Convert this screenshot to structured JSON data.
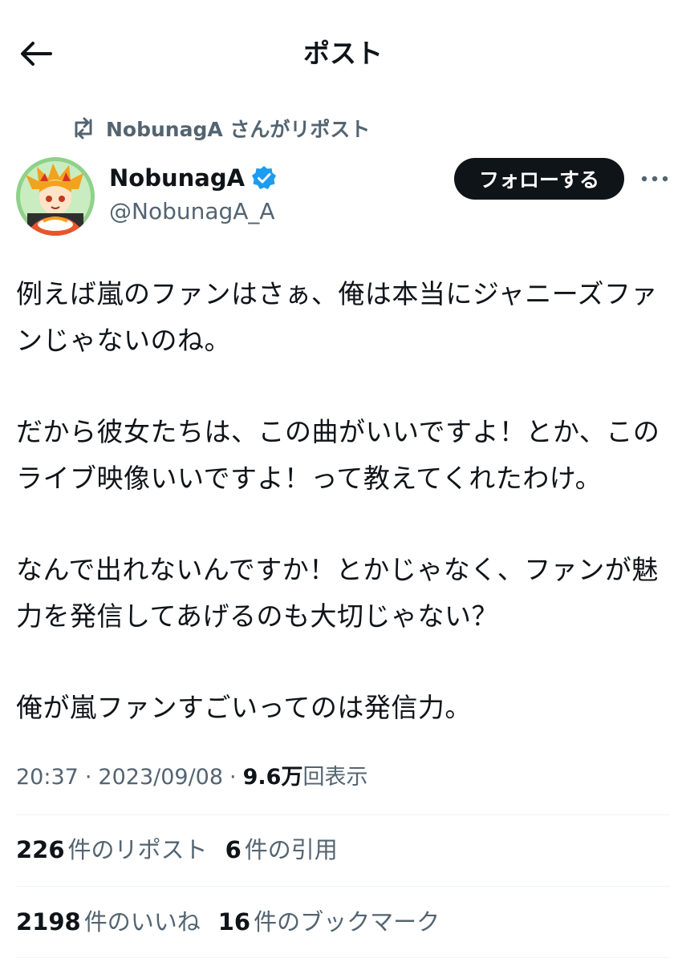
{
  "header": {
    "title": "ポスト",
    "back_icon": "arrow-left-icon"
  },
  "repost_context": {
    "icon": "repost-icon",
    "text": "NobunagA さんがリポスト"
  },
  "author": {
    "name": "NobunagA",
    "verified_icon": "verified-badge-icon",
    "handle": "@NobunagA_A",
    "follow_label": "フォローする",
    "more_icon": "more-icon"
  },
  "post": {
    "paragraphs": [
      "例えば嵐のファンはさぁ、俺は本当にジャニーズファンじゃないのね。",
      "だから彼女たちは、この曲がいいですよ！とか、このライブ映像いいですよ！って教えてくれたわけ。",
      "なんで出れないんですか！とかじゃなく、ファンが魅力を発信してあげるのも大切じゃない？",
      "俺が嵐ファンすごいってのは発信力。"
    ]
  },
  "meta": {
    "time": "20:37",
    "sep1": "·",
    "date": "2023/09/08",
    "sep2": "·",
    "views_num": "9.6万",
    "views_label": "回表示"
  },
  "stats": {
    "reposts_num": "226",
    "reposts_label": "件のリポスト",
    "quotes_num": "6",
    "quotes_label": "件の引用",
    "likes_num": "2198",
    "likes_label": "件のいいね",
    "bookmarks_num": "16",
    "bookmarks_label": "件のブックマーク"
  },
  "colors": {
    "text": "#0f1419",
    "secondary": "#536471",
    "verified": "#1d9bf0",
    "divider": "#eff3f4"
  }
}
